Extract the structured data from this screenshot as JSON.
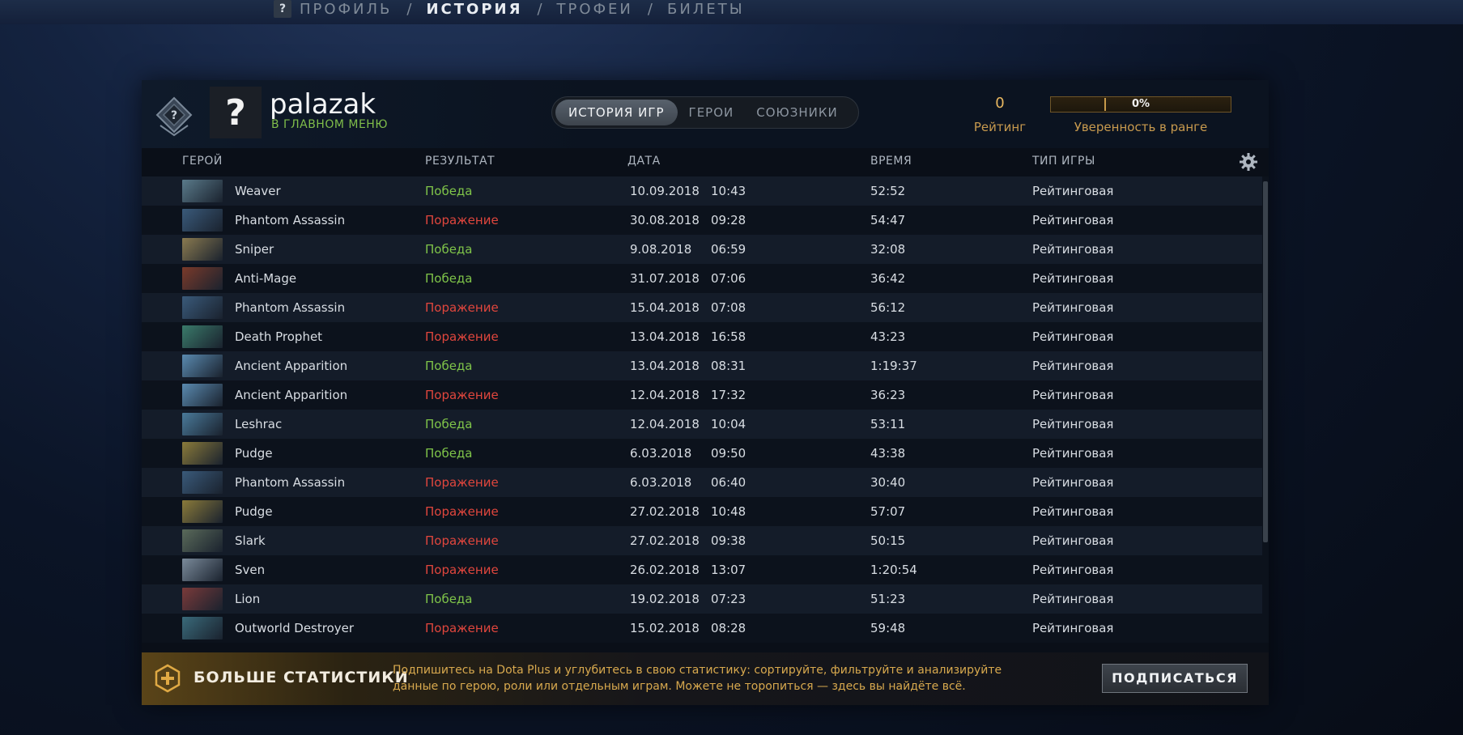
{
  "nav": {
    "help": "?",
    "items": [
      "ПРОФИЛЬ",
      "ИСТОРИЯ",
      "ТРОФЕИ",
      "БИЛЕТЫ"
    ],
    "separator": "/",
    "active": "ИСТОРИЯ"
  },
  "profile": {
    "avatar_glyph": "?",
    "username": "palazak",
    "status": "В ГЛАВНОМ МЕНЮ"
  },
  "tabs": [
    "ИСТОРИЯ ИГР",
    "ГЕРОИ",
    "СОЮЗНИКИ"
  ],
  "rating": {
    "value": "0",
    "label": "Рейтинг"
  },
  "confidence": {
    "text": "0%",
    "level_fraction": 0.0,
    "label": "Уверенность в ранге"
  },
  "columns": {
    "hero": "ГЕРОЙ",
    "result": "РЕЗУЛЬТАТ",
    "date": "ДАТА",
    "duration": "ВРЕМЯ",
    "game_type": "ТИП ИГРЫ"
  },
  "matches": [
    {
      "hero": "Weaver",
      "result": "Победа",
      "win": true,
      "date": "10.09.2018",
      "time": "10:43",
      "duration": "52:52",
      "type": "Рейтинговая",
      "color": "#5a7a8a"
    },
    {
      "hero": "Phantom Assassin",
      "result": "Поражение",
      "win": false,
      "date": "30.08.2018",
      "time": "09:28",
      "duration": "54:47",
      "type": "Рейтинговая",
      "color": "#3a5a7a"
    },
    {
      "hero": "Sniper",
      "result": "Победа",
      "win": true,
      "date": "9.08.2018",
      "time": "06:59",
      "duration": "32:08",
      "type": "Рейтинговая",
      "color": "#8a7a50"
    },
    {
      "hero": "Anti-Mage",
      "result": "Победа",
      "win": true,
      "date": "31.07.2018",
      "time": "07:06",
      "duration": "36:42",
      "type": "Рейтинговая",
      "color": "#7a3a2a"
    },
    {
      "hero": "Phantom Assassin",
      "result": "Поражение",
      "win": false,
      "date": "15.04.2018",
      "time": "07:08",
      "duration": "56:12",
      "type": "Рейтинговая",
      "color": "#3a5a7a"
    },
    {
      "hero": "Death Prophet",
      "result": "Поражение",
      "win": false,
      "date": "13.04.2018",
      "time": "16:58",
      "duration": "43:23",
      "type": "Рейтинговая",
      "color": "#3a7a6a"
    },
    {
      "hero": "Ancient Apparition",
      "result": "Победа",
      "win": true,
      "date": "13.04.2018",
      "time": "08:31",
      "duration": "1:19:37",
      "type": "Рейтинговая",
      "color": "#5a8ab0"
    },
    {
      "hero": "Ancient Apparition",
      "result": "Поражение",
      "win": false,
      "date": "12.04.2018",
      "time": "17:32",
      "duration": "36:23",
      "type": "Рейтинговая",
      "color": "#5a8ab0"
    },
    {
      "hero": "Leshrac",
      "result": "Победа",
      "win": true,
      "date": "12.04.2018",
      "time": "10:04",
      "duration": "53:11",
      "type": "Рейтинговая",
      "color": "#4a7a9a"
    },
    {
      "hero": "Pudge",
      "result": "Победа",
      "win": true,
      "date": "6.03.2018",
      "time": "09:50",
      "duration": "43:38",
      "type": "Рейтинговая",
      "color": "#8a7a3a"
    },
    {
      "hero": "Phantom Assassin",
      "result": "Поражение",
      "win": false,
      "date": "6.03.2018",
      "time": "06:40",
      "duration": "30:40",
      "type": "Рейтинговая",
      "color": "#3a5a7a"
    },
    {
      "hero": "Pudge",
      "result": "Поражение",
      "win": false,
      "date": "27.02.2018",
      "time": "10:48",
      "duration": "57:07",
      "type": "Рейтинговая",
      "color": "#8a7a3a"
    },
    {
      "hero": "Slark",
      "result": "Поражение",
      "win": false,
      "date": "27.02.2018",
      "time": "09:38",
      "duration": "50:15",
      "type": "Рейтинговая",
      "color": "#5a6a5a"
    },
    {
      "hero": "Sven",
      "result": "Поражение",
      "win": false,
      "date": "26.02.2018",
      "time": "13:07",
      "duration": "1:20:54",
      "type": "Рейтинговая",
      "color": "#7a8a9a"
    },
    {
      "hero": "Lion",
      "result": "Победа",
      "win": true,
      "date": "19.02.2018",
      "time": "07:23",
      "duration": "51:23",
      "type": "Рейтинговая",
      "color": "#7a3a3a"
    },
    {
      "hero": "Outworld Destroyer",
      "result": "Поражение",
      "win": false,
      "date": "15.02.2018",
      "time": "08:28",
      "duration": "59:48",
      "type": "Рейтинговая",
      "color": "#3a6a7a"
    }
  ],
  "promo": {
    "title": "БОЛЬШЕ СТАТИСТИКИ",
    "text": "Подпишитесь на Dota Plus и углубитесь в свою статистику: сортируйте, фильтруйте и анализируйте данные по герою, роли или отдельным играм. Можете не торопиться — здесь вы найдёте всё.",
    "button": "ПОДПИСАТЬСЯ"
  },
  "colors": {
    "win": "#7fc449",
    "loss": "#e0463d",
    "gold": "#c89a4e",
    "status": "#7fbd4a"
  }
}
